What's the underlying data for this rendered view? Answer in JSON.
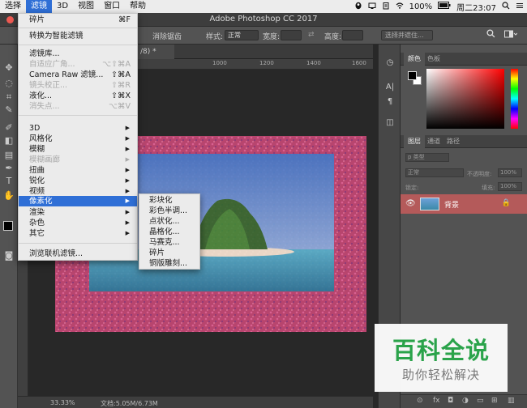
{
  "menubar": {
    "items": [
      "选择",
      "滤镜",
      "3D",
      "视图",
      "窗口",
      "帮助"
    ],
    "battery": "100%",
    "clock": "周二23:07"
  },
  "titlebar": {
    "title": "Adobe Photoshop CC 2017"
  },
  "options": {
    "style_label": "样式:",
    "style_value": "正常",
    "width_label": "宽度:",
    "height_label": "高度:",
    "antialias_label": "消除锯齿",
    "select_mask_btn": "选择并遮住..."
  },
  "document": {
    "tab_label": "/8) *",
    "ruler_ticks": [
      "1000",
      "1200",
      "1400",
      "1600"
    ]
  },
  "status": {
    "zoom": "33.33%",
    "doc_size": "文档:5.05M/6.73M"
  },
  "panels": {
    "color_tabs": [
      "颜色",
      "色板"
    ],
    "layer_tabs": [
      "图层",
      "通道",
      "路径"
    ],
    "kind_filter": "p 类型",
    "blend_mode": "正常",
    "opacity_label": "不透明度:",
    "opacity_value": "100%",
    "lock_label": "锁定:",
    "fill_label": "填充:",
    "fill_value": "100%",
    "layer_name": "背景"
  },
  "filter_menu": {
    "items": [
      {
        "label": "碎片",
        "shortcut": "⌘F"
      },
      {
        "label": "转换为智能滤镜"
      },
      {
        "label": "滤镜库..."
      },
      {
        "label": "自适应广角...",
        "shortcut": "⌥⇧⌘A"
      },
      {
        "label": "Camera Raw 滤镜...",
        "shortcut": "⇧⌘A"
      },
      {
        "label": "镜头校正...",
        "shortcut": "⇧⌘R"
      },
      {
        "label": "液化...",
        "shortcut": "⇧⌘X"
      },
      {
        "label": "消失点...",
        "shortcut": "⌥⌘V"
      },
      {
        "label": "3D"
      },
      {
        "label": "风格化"
      },
      {
        "label": "模糊"
      },
      {
        "label": "模糊画廊"
      },
      {
        "label": "扭曲"
      },
      {
        "label": "锐化"
      },
      {
        "label": "视频"
      },
      {
        "label": "像素化"
      },
      {
        "label": "渲染"
      },
      {
        "label": "杂色"
      },
      {
        "label": "其它"
      },
      {
        "label": "浏览联机滤镜..."
      }
    ]
  },
  "pixelate_submenu": {
    "items": [
      "彩块化",
      "彩色半调...",
      "点状化...",
      "晶格化...",
      "马赛克...",
      "碎片",
      "铜版雕刻..."
    ]
  },
  "watermark": {
    "main": "百科全说",
    "sub": "助你轻松解决"
  }
}
